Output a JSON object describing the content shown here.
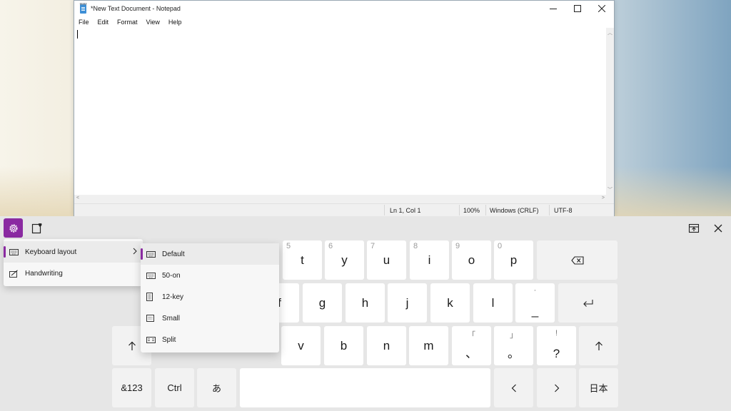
{
  "notepad": {
    "title": "*New Text Document - Notepad",
    "menu": [
      "File",
      "Edit",
      "Format",
      "View",
      "Help"
    ],
    "status": {
      "position": "Ln 1, Col 1",
      "zoom": "100%",
      "line_ending": "Windows (CRLF)",
      "encoding": "UTF-8"
    }
  },
  "keyboard": {
    "accent_color": "#8a2aa1",
    "toolbar": {
      "settings_icon": "gear-icon",
      "clipboard_icon": "clipboard-heart-icon",
      "dock_icon": "dock-icon",
      "close_icon": "close-icon"
    },
    "row1": [
      {
        "key": "t",
        "hint": "5"
      },
      {
        "key": "y",
        "hint": "6"
      },
      {
        "key": "u",
        "hint": "7"
      },
      {
        "key": "i",
        "hint": "8"
      },
      {
        "key": "o",
        "hint": "9"
      },
      {
        "key": "p",
        "hint": "0"
      }
    ],
    "row2": [
      "f",
      "g",
      "h",
      "j",
      "k",
      "l"
    ],
    "row2_underscore": {
      "key": "_",
      "hint": "·"
    },
    "row3": [
      "v",
      "b",
      "n",
      "m"
    ],
    "row3_punct": [
      {
        "key": "、",
        "hint": "「"
      },
      {
        "key": "。",
        "hint": "」"
      },
      {
        "key": "?",
        "hint": "!"
      }
    ],
    "bottom": {
      "num": "&123",
      "ctrl": "Ctrl",
      "kana": "あ",
      "lang": "日本"
    }
  },
  "settings_menu": {
    "items": [
      {
        "label": "Keyboard layout",
        "icon": "keyboard-icon"
      },
      {
        "label": "Handwriting",
        "icon": "handwriting-icon"
      }
    ]
  },
  "layout_menu": {
    "items": [
      {
        "label": "Default",
        "icon": "keyboard-icon"
      },
      {
        "label": "50-on",
        "icon": "keyboard-icon"
      },
      {
        "label": "12-key",
        "icon": "keypad-icon"
      },
      {
        "label": "Small",
        "icon": "small-keyboard-icon"
      },
      {
        "label": "Split",
        "icon": "split-keyboard-icon"
      }
    ]
  }
}
